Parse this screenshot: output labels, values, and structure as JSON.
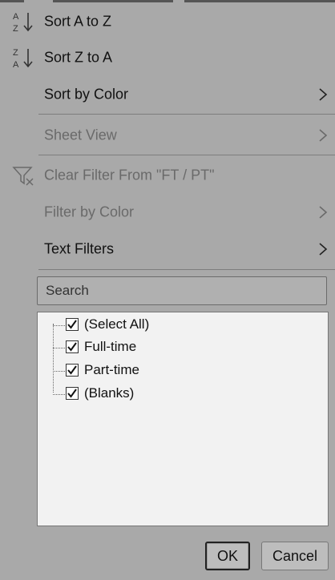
{
  "menu": {
    "sort_az": "Sort A to Z",
    "sort_za": "Sort Z to A",
    "sort_by_color": "Sort by Color",
    "sheet_view": "Sheet View",
    "clear_filter": "Clear Filter From \"FT / PT\"",
    "filter_by_color": "Filter by Color",
    "text_filters": "Text Filters"
  },
  "search": {
    "placeholder": "Search"
  },
  "filter_list": {
    "items": [
      {
        "label": "(Select All)",
        "checked": true
      },
      {
        "label": "Full-time",
        "checked": true
      },
      {
        "label": "Part-time",
        "checked": true
      },
      {
        "label": "(Blanks)",
        "checked": true
      }
    ]
  },
  "buttons": {
    "ok": "OK",
    "cancel": "Cancel"
  },
  "colors": {
    "background": "#a9a9a9",
    "list_background": "#f2f2f2",
    "disabled_text": "#6a6a6a"
  },
  "icons": {
    "sort_az": "sort-ascending-icon",
    "sort_za": "sort-descending-icon",
    "clear_filter": "clear-filter-icon",
    "submenu": "chevron-right-icon",
    "checkbox": "checkbox-checked-icon"
  }
}
